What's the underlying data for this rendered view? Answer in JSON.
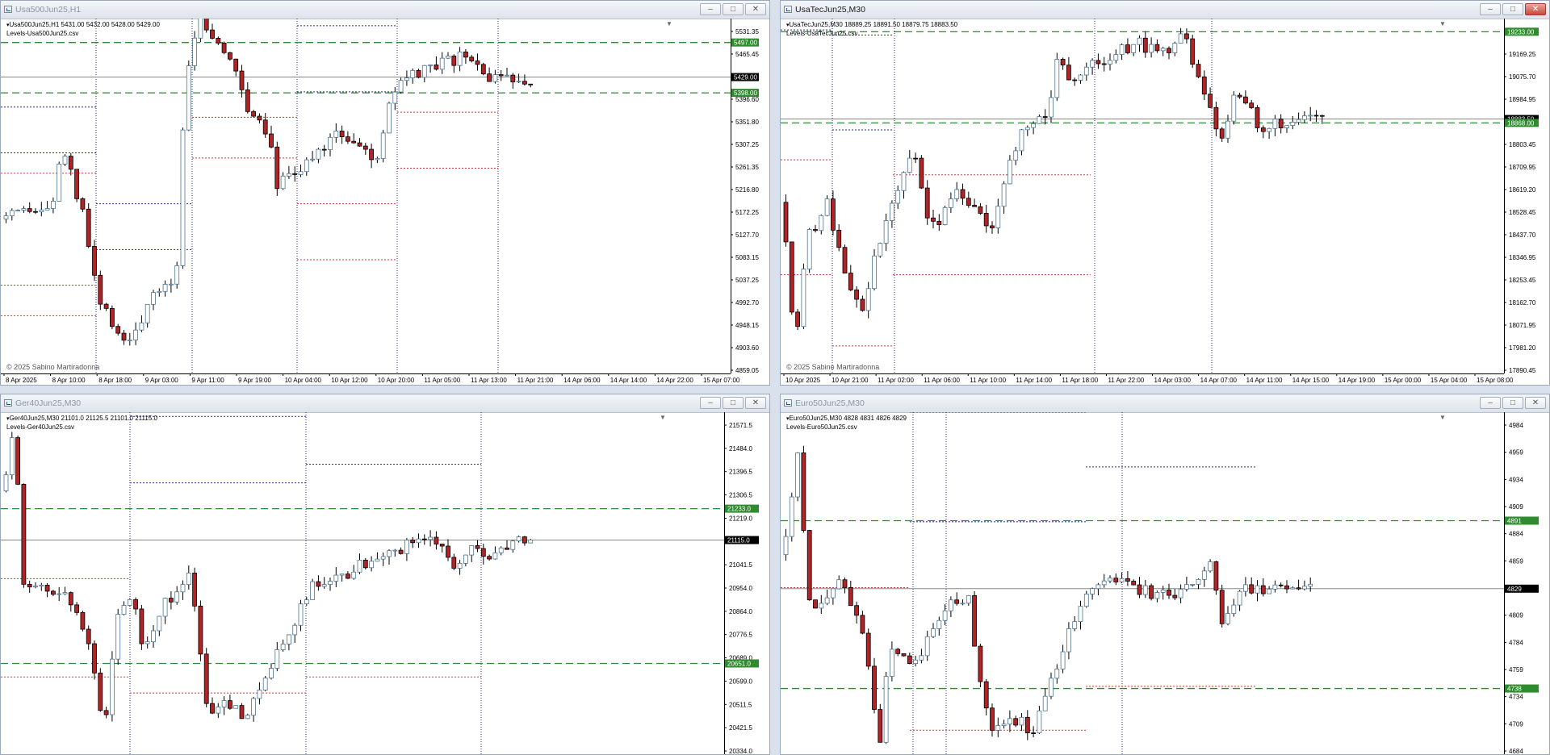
{
  "windows": [
    {
      "title": "Usa500Jun25,H1",
      "active": false,
      "header_line": "Usa500Jun25,H1  5431.00 5432.00 5428.00 5429.00",
      "indicator": "Levels-Usa500Jun25.csv",
      "copyright": "© 2025 Sabino Martiradonna",
      "y_axis": [
        "5531.35",
        "5465.45",
        "5440.90",
        "5396.60",
        "5351.80",
        "5307.25",
        "5261.35",
        "5216.80",
        "5172.25",
        "5127.70",
        "5083.15",
        "5037.25",
        "4992.70",
        "4948.15",
        "4903.60",
        "4859.05"
      ],
      "x_axis": [
        "8 Apr 2025",
        "8 Apr 10:00",
        "8 Apr 18:00",
        "9 Apr 03:00",
        "9 Apr 11:00",
        "9 Apr 19:00",
        "10 Apr 04:00",
        "10 Apr 12:00",
        "10 Apr 20:00",
        "11 Apr 05:00",
        "11 Apr 13:00",
        "11 Apr 21:00",
        "14 Apr 06:00",
        "14 Apr 14:00",
        "14 Apr 22:00",
        "15 Apr 07:00"
      ],
      "price_labels": [
        {
          "text": "5497.00",
          "price": 5497,
          "kind": "green"
        },
        {
          "text": "5429.00",
          "price": 5429,
          "kind": "black"
        },
        {
          "text": "5398.00",
          "price": 5398,
          "kind": "green"
        }
      ]
    },
    {
      "title": "UsaTecJun25,M30",
      "active": true,
      "header_line": "UsaTecJun25,M30  18889.25 18891.50 18879.75 18883.50",
      "indicator": "Levels-UsaTecJun25.csv",
      "copyright": "© 2025 Sabino Martiradonna",
      "y_axis": [
        "19259.95",
        "19169.25",
        "19075.70",
        "18984.95",
        "18894.25",
        "18803.45",
        "18709.95",
        "18619.20",
        "18528.45",
        "18437.70",
        "18346.95",
        "18253.45",
        "18162.70",
        "18071.95",
        "17981.20",
        "17890.45"
      ],
      "x_axis": [
        "10 Apr 2025",
        "10 Apr 21:00",
        "11 Apr 02:00",
        "11 Apr 06:00",
        "11 Apr 10:00",
        "11 Apr 14:00",
        "11 Apr 18:00",
        "11 Apr 22:00",
        "14 Apr 03:00",
        "14 Apr 07:00",
        "14 Apr 11:00",
        "14 Apr 15:00",
        "14 Apr 19:00",
        "15 Apr 00:00",
        "15 Apr 04:00",
        "15 Apr 08:00"
      ],
      "price_labels": [
        {
          "text": "19233.00",
          "price": 19233,
          "kind": "green"
        },
        {
          "text": "18883.50",
          "price": 18883.5,
          "kind": "black"
        },
        {
          "text": "18868.00",
          "price": 18868,
          "kind": "green"
        }
      ]
    },
    {
      "title": "Ger40Jun25,M30",
      "active": false,
      "header_line": "Ger40Jun25,M30  21101.0 21125.5 21101.0 21115.0",
      "indicator": "Levels-Ger40Jun25.csv",
      "copyright": "",
      "y_axis": [
        "21571.5",
        "21484.0",
        "21396.5",
        "21306.5",
        "21219.0",
        "21131.5",
        "21041.5",
        "20954.0",
        "20864.0",
        "20776.5",
        "20689.0",
        "20599.0",
        "20511.5",
        "20421.5",
        "20334.0"
      ],
      "x_axis": [],
      "price_labels": [
        {
          "text": "21233.0",
          "price": 21233,
          "kind": "green"
        },
        {
          "text": "21115.0",
          "price": 21115,
          "kind": "black"
        },
        {
          "text": "20651.0",
          "price": 20651,
          "kind": "green"
        }
      ]
    },
    {
      "title": "Euro50Jun25,M30",
      "active": false,
      "header_line": "Euro50Jun25,M30  4828 4831 4826 4829",
      "indicator": "Levels-Euro50Jun25.csv",
      "copyright": "",
      "y_axis": [
        "4984",
        "4959",
        "4934",
        "4909",
        "4884",
        "4859",
        "4834",
        "4809",
        "4784",
        "4759",
        "4734",
        "4709",
        "4684"
      ],
      "x_axis": [],
      "price_labels": [
        {
          "text": "4891",
          "price": 4891,
          "kind": "green"
        },
        {
          "text": "4829",
          "price": 4829,
          "kind": "black"
        },
        {
          "text": "4738",
          "price": 4738,
          "kind": "green"
        }
      ]
    }
  ],
  "window_buttons": {
    "minimize": "–",
    "maximize": "□",
    "close": "✕"
  },
  "colors": {
    "bull": "#4e7592",
    "bear": "#b02427",
    "green_level": "#2e8b2e",
    "red_level": "#d23a3a",
    "blue_level": "#2a2a8a",
    "grid": "#1a1a1a"
  }
}
